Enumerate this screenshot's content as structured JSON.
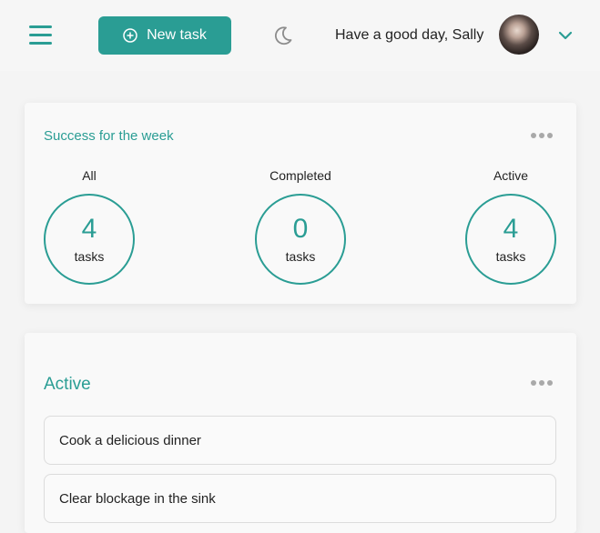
{
  "header": {
    "new_task_label": "New task",
    "greeting": "Have a good day, Sally"
  },
  "icons": {
    "menu": "hamburger-menu-icon",
    "add": "plus-circle-icon",
    "theme": "moon-icon",
    "account_menu": "chevron-down-icon",
    "more": "more-dots-icon"
  },
  "week_card": {
    "title": "Success for the week",
    "stats": [
      {
        "label": "All",
        "value": "4",
        "unit": "tasks"
      },
      {
        "label": "Completed",
        "value": "0",
        "unit": "tasks"
      },
      {
        "label": "Active",
        "value": "4",
        "unit": "tasks"
      }
    ]
  },
  "active_card": {
    "title": "Active",
    "tasks": [
      {
        "text": "Cook a delicious dinner"
      },
      {
        "text": "Clear blockage in the sink"
      }
    ]
  },
  "colors": {
    "accent": "#2a9d94",
    "background": "#f4f4f4",
    "card": "#f9f9f9"
  }
}
